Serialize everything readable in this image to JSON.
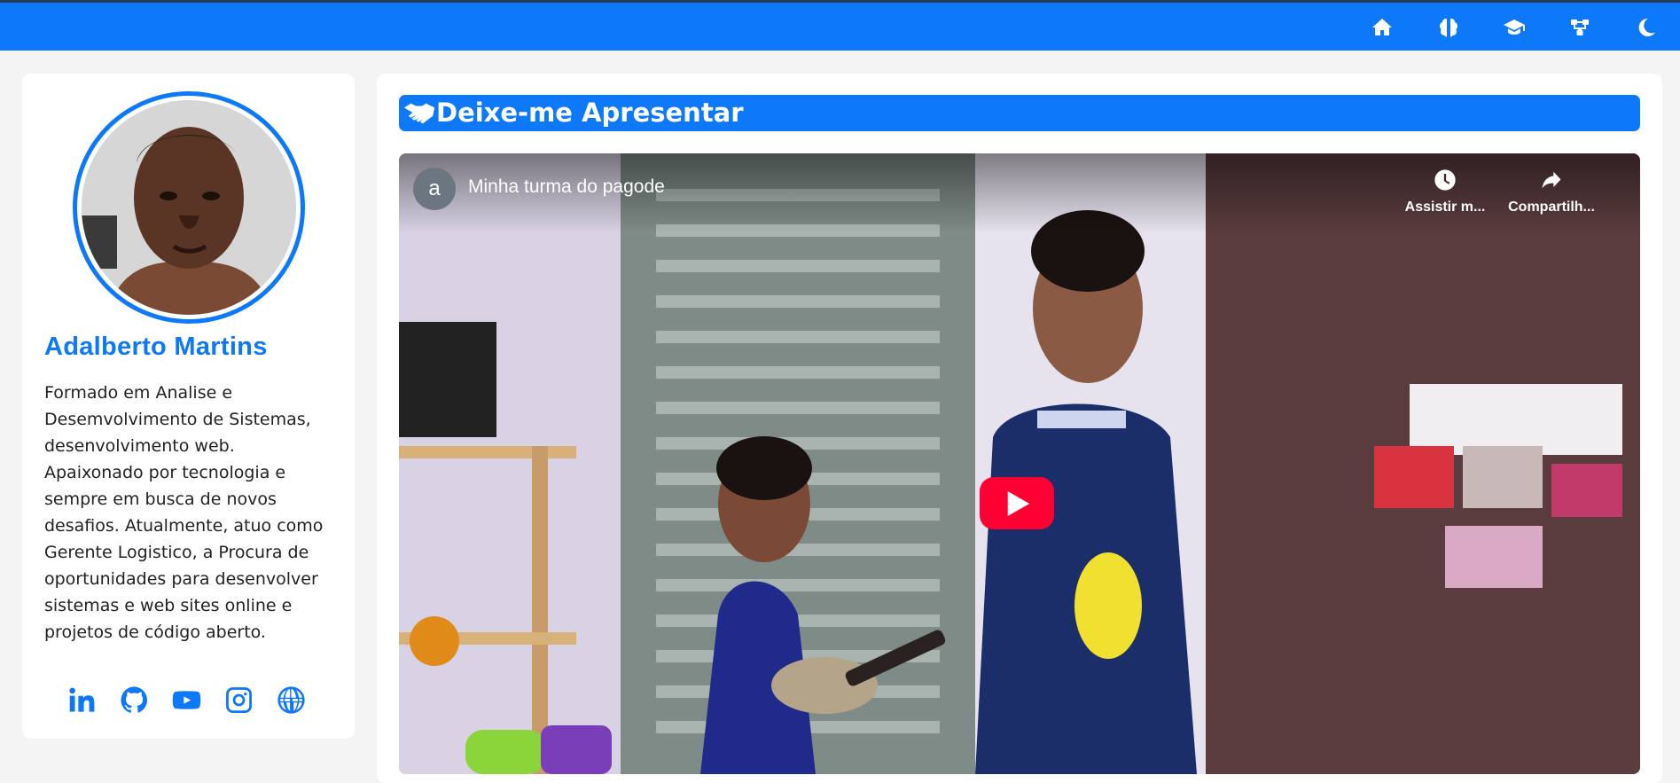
{
  "nav": {
    "icons": [
      "home-icon",
      "brain-icon",
      "graduation-cap-icon",
      "diagram-icon",
      "moon-icon"
    ]
  },
  "profile": {
    "name": "Adalberto Martins",
    "bio": "Formado em Analise e Desemvolvimento de Sistemas, desenvolvimento web. Apaixonado por tecnologia e sempre em busca de novos desafios. Atualmente, atuo como Gerente Logistico, a Procura de oportunidades para desenvolver sistemas e web sites online e projetos de código aberto.",
    "social_icons": [
      "linkedin-icon",
      "github-icon",
      "youtube-icon",
      "instagram-icon",
      "globe-icon"
    ]
  },
  "section": {
    "title": "Deixe-me Apresentar",
    "icon": "handshake-icon"
  },
  "video": {
    "channel_initial": "a",
    "title": "Minha turma do pagode",
    "watch_later_label": "Assistir m...",
    "share_label": "Compartilh..."
  },
  "colors": {
    "accent": "#0d78f8",
    "background": "#f4f4f4",
    "play_button": "#ff0033"
  }
}
